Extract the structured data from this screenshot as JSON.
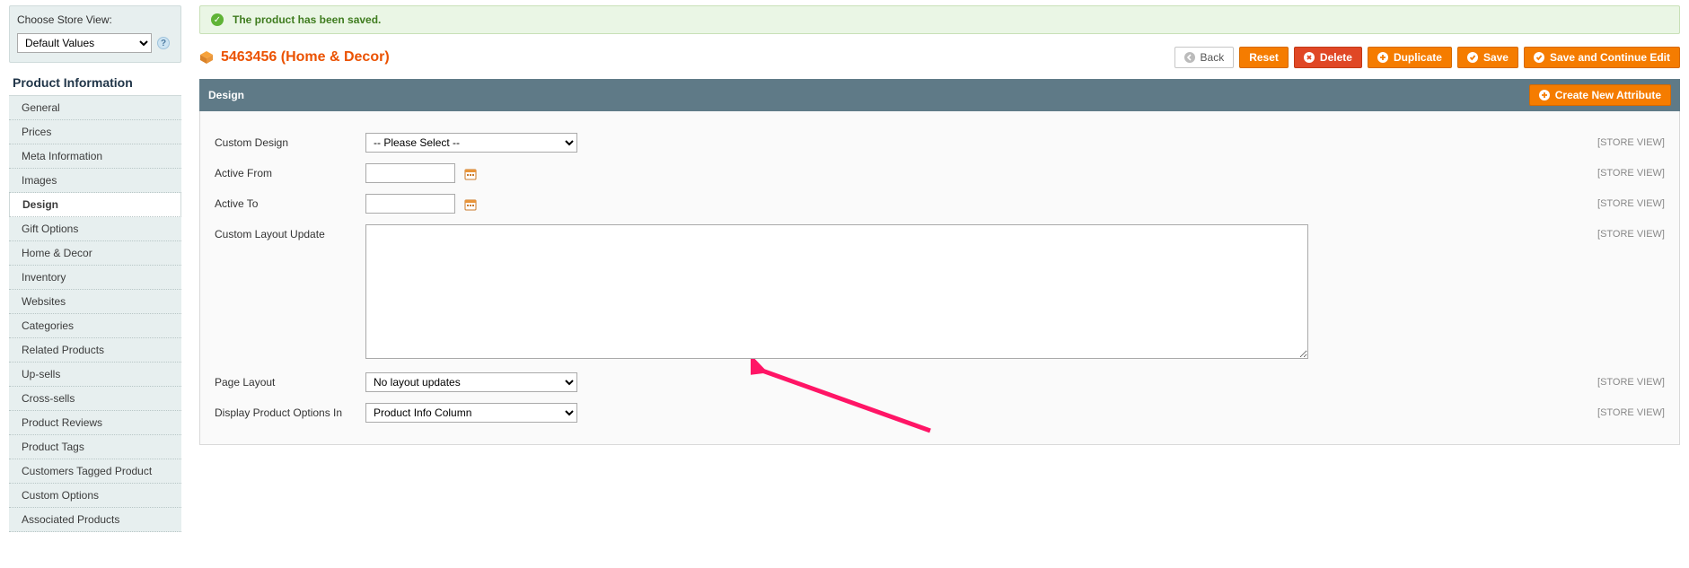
{
  "storeView": {
    "label": "Choose Store View:",
    "value": "Default Values"
  },
  "sidebar": {
    "title": "Product Information",
    "tabs": [
      {
        "label": "General"
      },
      {
        "label": "Prices"
      },
      {
        "label": "Meta Information"
      },
      {
        "label": "Images"
      },
      {
        "label": "Design",
        "active": true
      },
      {
        "label": "Gift Options"
      },
      {
        "label": "Home & Decor"
      },
      {
        "label": "Inventory"
      },
      {
        "label": "Websites"
      },
      {
        "label": "Categories"
      },
      {
        "label": "Related Products"
      },
      {
        "label": "Up-sells"
      },
      {
        "label": "Cross-sells"
      },
      {
        "label": "Product Reviews"
      },
      {
        "label": "Product Tags"
      },
      {
        "label": "Customers Tagged Product"
      },
      {
        "label": "Custom Options"
      },
      {
        "label": "Associated Products"
      }
    ]
  },
  "message": "The product has been saved.",
  "product": {
    "title": "5463456 (Home & Decor)"
  },
  "buttons": {
    "back": "Back",
    "reset": "Reset",
    "delete": "Delete",
    "duplicate": "Duplicate",
    "save": "Save",
    "saveContinue": "Save and Continue Edit",
    "createAttr": "Create New Attribute"
  },
  "panel": {
    "title": "Design",
    "scope": "[STORE VIEW]",
    "fields": {
      "customDesign": {
        "label": "Custom Design",
        "value": "-- Please Select --"
      },
      "activeFrom": {
        "label": "Active From",
        "value": ""
      },
      "activeTo": {
        "label": "Active To",
        "value": ""
      },
      "layoutUpdate": {
        "label": "Custom Layout Update",
        "value": ""
      },
      "pageLayout": {
        "label": "Page Layout",
        "value": "No layout updates"
      },
      "displayOptions": {
        "label": "Display Product Options In",
        "value": "Product Info Column"
      }
    }
  }
}
